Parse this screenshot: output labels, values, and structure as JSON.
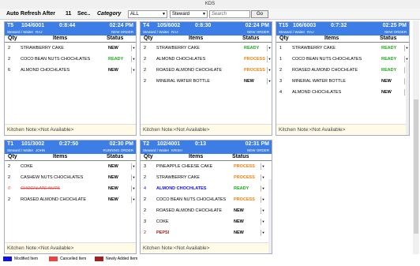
{
  "window": {
    "title": "KDS"
  },
  "toolbar": {
    "auto_refresh_label": "Auto Refresh After",
    "auto_refresh_value": "11",
    "sec_label": "Sec..",
    "category_label": "Category",
    "category_value": "ALL",
    "steward_value": "Steward",
    "search_placeholder": "Search",
    "go_label": "Go"
  },
  "orders": [
    {
      "table": "T5",
      "order_no": "104/6001",
      "time": "0:8:44",
      "placed": "02:24 PM",
      "steward_label": "Steward / Waiter",
      "steward": "RAJ",
      "status": "NEW ORDER",
      "items": [
        {
          "qty": "2",
          "name": "STRAWBERRY CAKE",
          "status": "NEW",
          "type": "normal"
        },
        {
          "qty": "2",
          "name": "COCO BEAN NUTS CHOCHLATES",
          "status": "READY",
          "type": "normal"
        },
        {
          "qty": "6",
          "name": "ALMOND CHOCHLATES",
          "status": "NEW",
          "type": "normal"
        }
      ],
      "note_label": "Kitchen Note:",
      "note": "<Not Available>"
    },
    {
      "table": "T4",
      "order_no": "105/6002",
      "time": "0:8:30",
      "placed": "02:24 PM",
      "steward_label": "Steward / Waiter",
      "steward": "RAJ",
      "status": "NEW ORDER",
      "items": [
        {
          "qty": "2",
          "name": "STRAWBERRY CAKE",
          "status": "READY",
          "type": "normal"
        },
        {
          "qty": "2",
          "name": "ALMOND CHOCHLATES",
          "status": "PROCESS",
          "type": "normal"
        },
        {
          "qty": "2",
          "name": "ROASED ALMOND CHOCHLATE",
          "status": "PROCESS",
          "type": "normal"
        },
        {
          "qty": "2",
          "name": "MINERAL WATER BOTTLE",
          "status": "NEW",
          "type": "normal"
        }
      ],
      "note_label": "Kitchen Note:",
      "note": "<Not Available>"
    },
    {
      "table": "T15",
      "order_no": "106/6003",
      "time": "0:7:32",
      "placed": "02:25 PM",
      "steward_label": "Steward / Waiter",
      "steward": "RAJ",
      "status": "NEW ORDER",
      "items": [
        {
          "qty": "1",
          "name": "STRAWBERRY CAKE",
          "status": "READY",
          "type": "normal"
        },
        {
          "qty": "1",
          "name": "COCO BEAN NUTS CHOCHLATES",
          "status": "READY",
          "type": "normal"
        },
        {
          "qty": "2",
          "name": "ROASED ALMOND CHOCHLATE",
          "status": "READY",
          "type": "normal"
        },
        {
          "qty": "3",
          "name": "MINERAL WATER BOTTLE",
          "status": "NEW",
          "type": "normal"
        },
        {
          "qty": "4",
          "name": "ALMOND CHOCHLATES",
          "status": "NEW",
          "type": "normal"
        }
      ],
      "note_label": "Kitchen Note:",
      "note": "<Not Available>"
    },
    {
      "table": "T1",
      "order_no": "101/3002",
      "time": "0:27:50",
      "placed": "02:30 PM",
      "steward_label": "Steward / Waiter",
      "steward": "JOHN",
      "status": "RUNNING ORDER",
      "items": [
        {
          "qty": "2",
          "name": "COKE",
          "status": "NEW",
          "type": "normal"
        },
        {
          "qty": "2",
          "name": "CASHEW NUTS CHOCHLATES",
          "status": "NEW",
          "type": "normal"
        },
        {
          "qty": "0",
          "name": "CHOCHLATE NUTS",
          "status": "NEW",
          "type": "cancelled"
        },
        {
          "qty": "2",
          "name": "ROASED ALMOND CHOCHLATE",
          "status": "NEW",
          "type": "normal"
        }
      ],
      "note_label": "Kitchen Note:",
      "note": "<Not Available>"
    },
    {
      "table": "T2",
      "order_no": "102/4001",
      "time": "0:13",
      "placed": "02:31 PM",
      "steward_label": "Steward / Waiter",
      "steward": "KRISH",
      "status": "NEW ORDER",
      "items": [
        {
          "qty": "3",
          "name": "PINEAPPLE CHEESE CAKE",
          "status": "PROCESS",
          "type": "normal"
        },
        {
          "qty": "2",
          "name": "STRAWBERRY CAKE",
          "status": "PROCESS",
          "type": "normal"
        },
        {
          "qty": "4",
          "name": "ALMOND CHOCHLATES",
          "status": "READY",
          "type": "modified"
        },
        {
          "qty": "2",
          "name": "COCO BEAN NUTS CHOCHLATES",
          "status": "PROCESS",
          "type": "normal"
        },
        {
          "qty": "2",
          "name": "ROASED ALMOND CHOCHLATE",
          "status": "NEW",
          "type": "normal"
        },
        {
          "qty": "3",
          "name": "COKE",
          "status": "NEW",
          "type": "normal"
        },
        {
          "qty": "2",
          "name": "PEPSI",
          "status": "NEW",
          "type": "new"
        }
      ],
      "note_label": "Kitchen Note:",
      "note": "<Not Available>"
    }
  ],
  "columns": {
    "qty": "Qty",
    "items": "Items",
    "status": "Status"
  },
  "legend": [
    {
      "label": "Modified Item",
      "color": "#1010e0"
    },
    {
      "label": "Cancelled Item",
      "color": "#f04040"
    },
    {
      "label": "Newly Added Item",
      "color": "#a02020"
    }
  ],
  "colors": {
    "header": "#3c7ee6",
    "ready": "#1aaa1a",
    "process": "#f08010",
    "new": "#000000",
    "modified": "#1010e0",
    "cancelled": "#f04040",
    "newly_added": "#a02020"
  }
}
